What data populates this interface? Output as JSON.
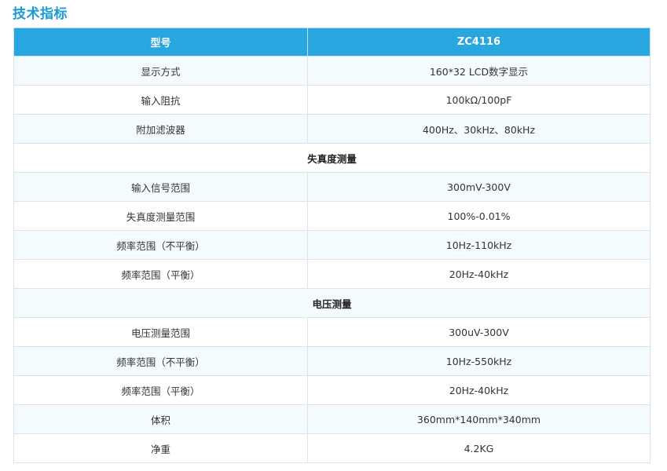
{
  "section_title": "技术指标",
  "table": {
    "header": {
      "col1": "型号",
      "col2": "ZC4116"
    },
    "rows": [
      {
        "type": "pair",
        "label": "显示方式",
        "value": "160*32 LCD数字显示"
      },
      {
        "type": "pair",
        "label": "输入阻抗",
        "value": "100kΩ/100pF"
      },
      {
        "type": "pair",
        "label": "附加滤波器",
        "value": "400Hz、30kHz、80kHz"
      },
      {
        "type": "group",
        "label": "失真度测量"
      },
      {
        "type": "pair",
        "label": "输入信号范围",
        "value": "300mV-300V"
      },
      {
        "type": "pair",
        "label": "失真度测量范围",
        "value": "100%-0.01%"
      },
      {
        "type": "pair",
        "label": "频率范围（不平衡）",
        "value": "10Hz-110kHz"
      },
      {
        "type": "pair",
        "label": "频率范围（平衡）",
        "value": "20Hz-40kHz"
      },
      {
        "type": "group",
        "label": "电压测量"
      },
      {
        "type": "pair",
        "label": "电压测量范围",
        "value": "300uV-300V"
      },
      {
        "type": "pair",
        "label": "频率范围（不平衡）",
        "value": "10Hz-550kHz"
      },
      {
        "type": "pair",
        "label": "频率范围（平衡）",
        "value": "20Hz-40kHz"
      },
      {
        "type": "pair",
        "label": "体积",
        "value": "360mm*140mm*340mm"
      },
      {
        "type": "pair",
        "label": "净重",
        "value": "4.2KG"
      }
    ]
  }
}
